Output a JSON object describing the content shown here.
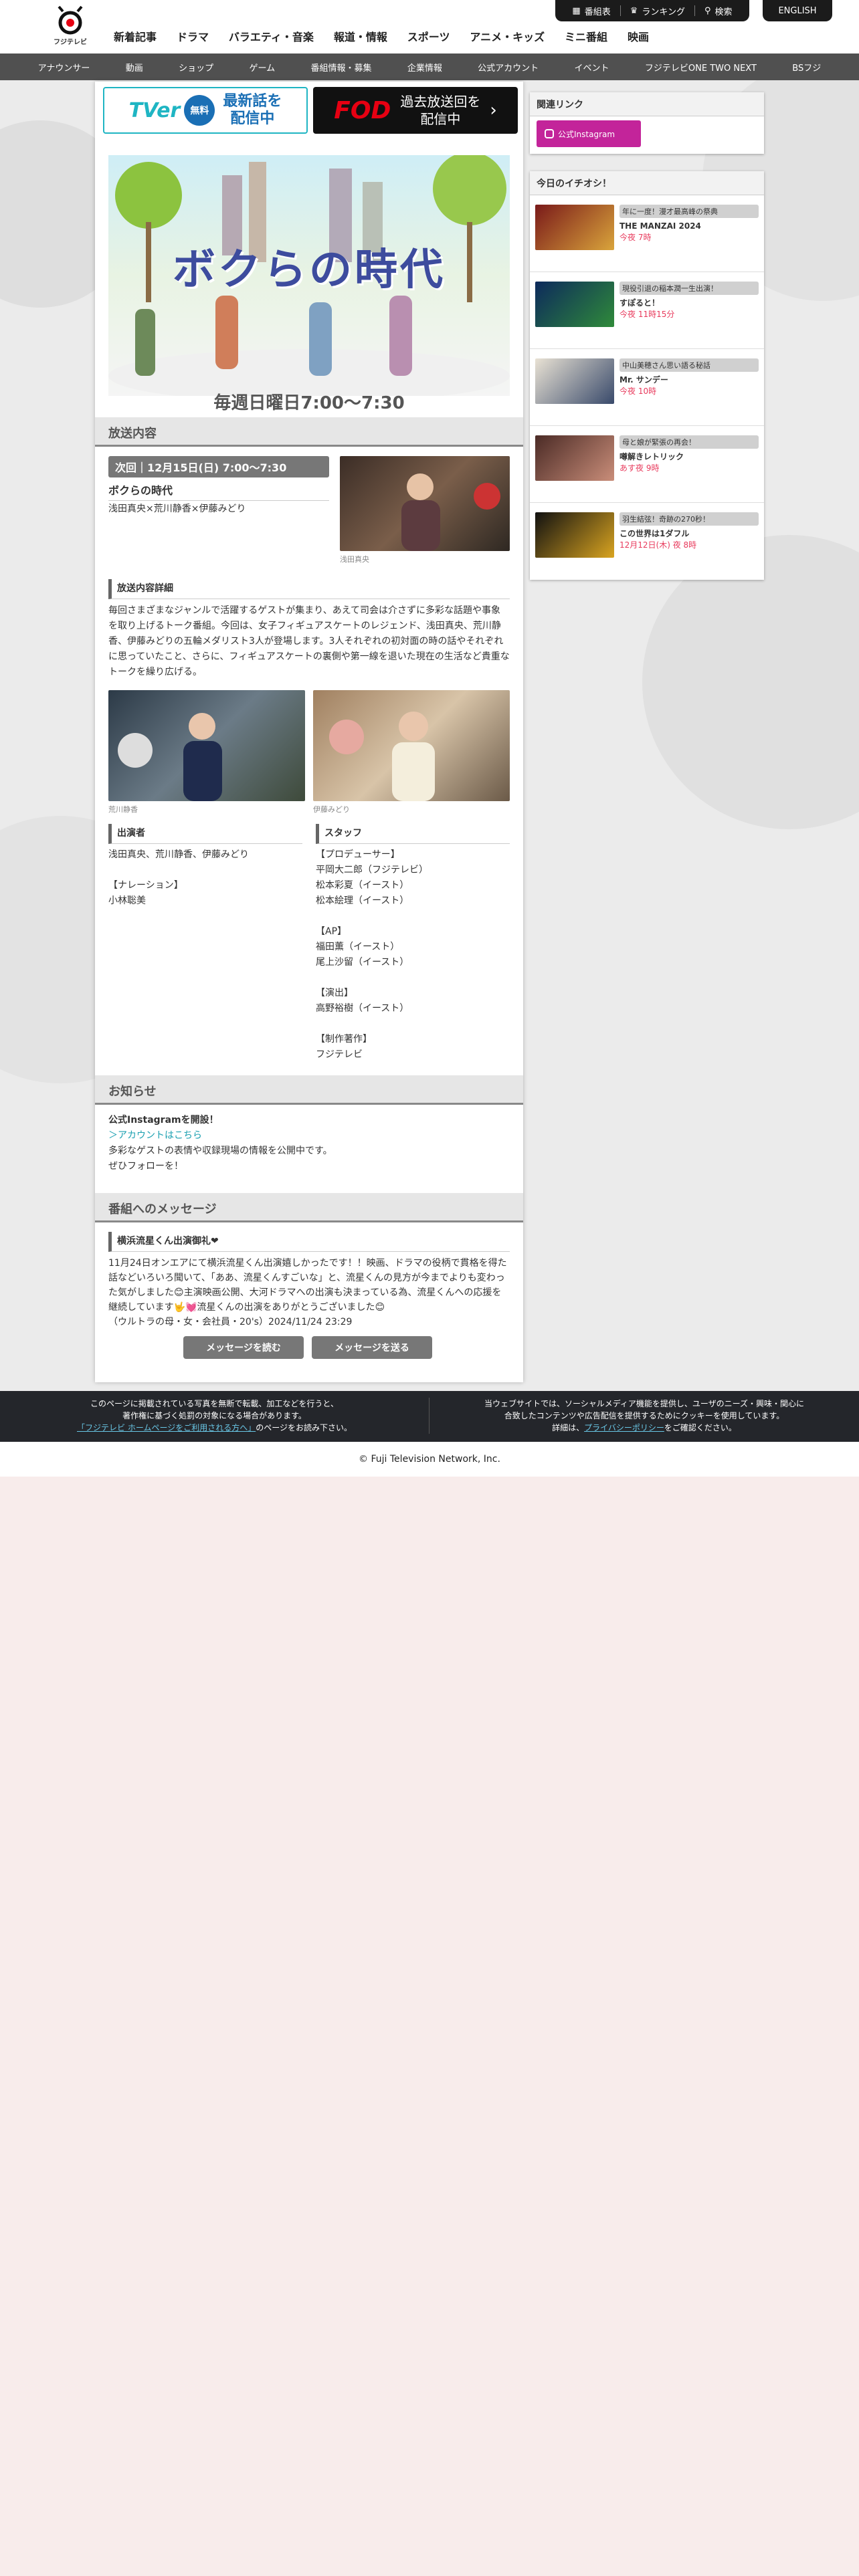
{
  "header": {
    "logo_text": "フジテレビ",
    "nav": [
      "新着記事",
      "ドラマ",
      "バラエティ・音楽",
      "報道・情報",
      "スポーツ",
      "アニメ・キッズ",
      "ミニ番組",
      "映画"
    ],
    "util": {
      "program_guide": "番組表",
      "ranking": "ランキング",
      "search": "検索"
    },
    "english": "ENGLISH"
  },
  "subnav": [
    "アナウンサー",
    "動画",
    "ショップ",
    "ゲーム",
    "番組情報・募集",
    "企業情報",
    "公式アカウント",
    "イベント",
    "フジテレビONE TWO NEXT",
    "BSフジ"
  ],
  "banners": {
    "tver_logo": "TVer",
    "tver_free": "無料",
    "tver_line1": "最新話を",
    "tver_line2": "配信中",
    "fod_logo": "FOD",
    "fod_line1": "過去放送回を",
    "fod_line2": "配信中"
  },
  "program": {
    "title_art": "ボクらの時代",
    "schedule": "毎週日曜日7:00〜7:30"
  },
  "broadcast": {
    "heading": "放送内容",
    "next_label": "次回｜12月15日(日) 7:00〜7:30",
    "episode_title": "ボクらの時代",
    "guests": "浅田真央×荒川静香×伊藤みどり",
    "photo1_caption": "浅田真央",
    "detail_heading": "放送内容詳細",
    "detail_text": "毎回さまざまなジャンルで活躍するゲストが集まり、あえて司会は介さずに多彩な話題や事象を取り上げるトーク番組。今回は、女子フィギュアスケートのレジェンド、浅田真央、荒川静香、伊藤みどりの五輪メダリスト3人が登場します。3人それぞれの初対面の時の話やそれぞれに思っていたこと、さらに、フィギュアスケートの裏側や第一線を退いた現在の生活など貴重なトークを繰り広げる。",
    "photo2_caption": "荒川静香",
    "photo3_caption": "伊藤みどり",
    "cast_heading": "出演者",
    "cast_lines": [
      "浅田真央、荒川静香、伊藤みどり",
      "",
      "【ナレーション】",
      "小林聡美"
    ],
    "staff_heading": "スタッフ",
    "staff_lines": [
      "【プロデューサー】",
      "平岡大二郎（フジテレビ）",
      "松本彩夏（イースト）",
      "松本絵理（イースト）",
      "",
      "【AP】",
      "福田薫（イースト）",
      "尾上沙留（イースト）",
      "",
      "【演出】",
      "高野裕樹（イースト）",
      "",
      "【制作著作】",
      "フジテレビ"
    ]
  },
  "news": {
    "heading": "お知らせ",
    "bold": "公式Instagramを開設！",
    "link": "＞アカウントはこちら",
    "line1": "多彩なゲストの表情や収録現場の情報を公開中です。",
    "line2": "ぜひフォローを！"
  },
  "message": {
    "heading": "番組へのメッセージ",
    "title": "横浜流星くん出演御礼❤",
    "body": "11月24日オンエアにて横浜流星くん出演嬉しかったです！！映画、ドラマの役柄で貫格を得た話などいろいろ聞いて、「ああ、流星くんすごいな」と、流星くんの見方が今までよりも変わった気がしました😊主演映画公開、大河ドラマへの出演も決まっている為、流星くんへの応援を継続しています🤟💓流星くんの出演をありがとうございました😊",
    "meta": "（ウルトラの母・女・会社員・20's）2024/11/24 23:29",
    "read_btn": "メッセージを読む",
    "send_btn": "メッセージを送る"
  },
  "sidebar": {
    "related_heading": "関連リンク",
    "instagram": "公式Instagram",
    "pick_heading": "今日のイチオシ！",
    "items": [
      {
        "tag": "年に一度！漫才最高峰の祭典",
        "title": "THE MANZAI 2024",
        "time": "今夜 7時"
      },
      {
        "tag": "現役引退の稲本潤一生出演！",
        "title": "すぽると！",
        "time": "今夜 11時15分"
      },
      {
        "tag": "中山美穂さん思い語る秘話",
        "title": "Mr. サンデー",
        "time": "今夜 10時"
      },
      {
        "tag": "母と娘が緊張の再会！",
        "title": "噂解きレトリック",
        "time": "あす夜 9時"
      },
      {
        "tag": "羽生結弦！奇跡の270秒！",
        "title": "この世界は1ダフル",
        "time": "12月12日(木) 夜 8時"
      }
    ]
  },
  "notice": {
    "left1": "このページに掲載されている写真を無断で転載、加工などを行うと、",
    "left2": "著作権に基づく処罰の対象になる場合があります。",
    "left_link": "「フジテレビ ホームページをご利用される方へ」",
    "left3": "のページをお読み下さい。",
    "right1": "当ウェブサイトでは、ソーシャルメディア機能を提供し、ユーザのニーズ・興味・関心に",
    "right2": "合致したコンテンツや広告配信を提供するためにクッキーを使用しています。",
    "right3a": "詳細は、",
    "right_link": "プライバシーポリシー",
    "right3b": "をご確認ください。"
  },
  "footer": "© Fuji Television Network, Inc."
}
